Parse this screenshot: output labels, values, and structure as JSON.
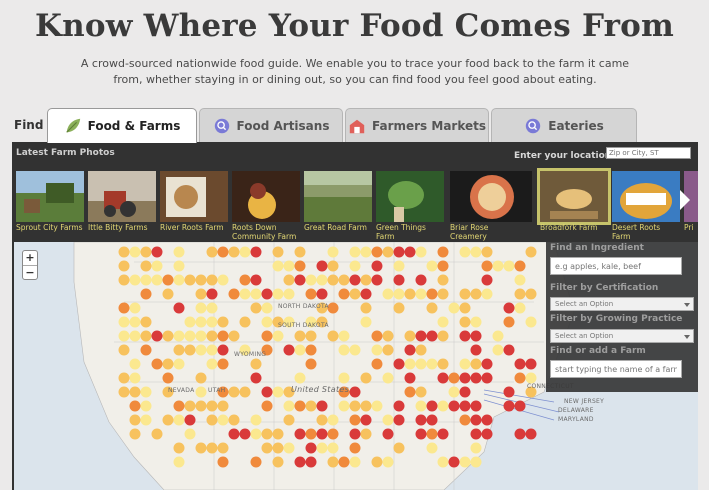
{
  "hero": {
    "title": "Know Where Your Food Comes From",
    "subtitle": "A crowd-sourced nationwide food guide. We enable you to trace your food back to the farm it came from, whether staying in or dining out, so you can find food you feel good about eating."
  },
  "find_label": "Find",
  "tabs": [
    {
      "label": "Food & Farms",
      "icon": "leaf-icon",
      "active": true
    },
    {
      "label": "Food Artisans",
      "icon": "search-icon",
      "active": false
    },
    {
      "label": "Farmers Markets",
      "icon": "barn-icon",
      "active": false
    },
    {
      "label": "Eateries",
      "icon": "search-icon",
      "active": false
    }
  ],
  "photos": {
    "heading": "Latest Farm Photos",
    "location_label": "Enter your location:",
    "location_placeholder": "Zip or City, ST",
    "items": [
      {
        "caption": "Sprout City Farms"
      },
      {
        "caption": "Ittle Bitty Farms"
      },
      {
        "caption": "River Roots Farm"
      },
      {
        "caption": "Roots Down Community Farm"
      },
      {
        "caption": "Great Road Farm"
      },
      {
        "caption": "Green Things Farm"
      },
      {
        "caption": "Briar Rose Creamery"
      },
      {
        "caption": "Broadfork Farm",
        "selected": true
      },
      {
        "caption": "Desert Roots Farm"
      },
      {
        "caption": "Pri"
      }
    ]
  },
  "filters": {
    "ingredient_label": "Find an Ingredient",
    "ingredient_placeholder": "e.g apples, kale, beef",
    "certification_label": "Filter by Certification",
    "certification_value": "Select an Option",
    "practice_label": "Filter by Growing Practice",
    "practice_value": "Select an Option",
    "farm_label": "Find or add a Farm",
    "farm_placeholder": "start typing the name of a farm"
  },
  "map": {
    "zoom_in": "+",
    "zoom_out": "−",
    "labels": {
      "north_dakota": "NORTH DAKOTA",
      "south_dakota": "SOUTH DAKOTA",
      "wyoming": "WYOMING",
      "nevada": "NEVADA",
      "utah": "UTAH",
      "united_states": "United States",
      "connecticut": "CONNECTICUT",
      "new_jersey": "NEW JERSEY",
      "delaware": "DELAWARE",
      "maryland": "MARYLAND"
    }
  },
  "colors": {
    "page_bg": "#ebeaea",
    "panel_bg": "#323232",
    "caption": "#e2d774",
    "marker_hot": "#d93a3a",
    "marker_mid": "#f08a3c",
    "marker_low": "#f7c25e",
    "marker_min": "#fbe88f"
  }
}
